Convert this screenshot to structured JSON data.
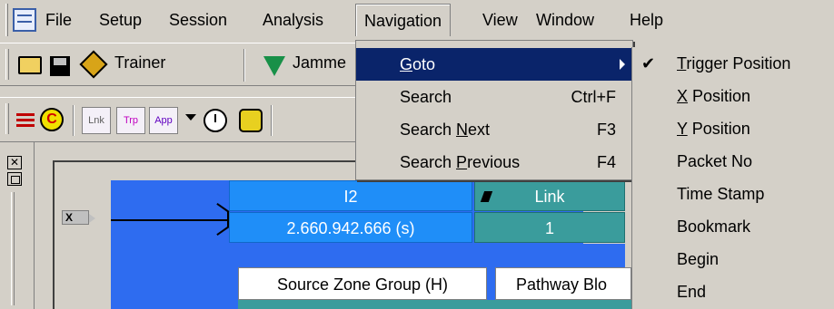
{
  "menubar": {
    "items": [
      "File",
      "Setup",
      "Session",
      "Analysis",
      "Navigation",
      "View",
      "Window",
      "Help"
    ]
  },
  "toolbar1": {
    "trainer_label": "Trainer",
    "jammer_label": "Jamme"
  },
  "toolbar2": {
    "lnk": "Lnk",
    "trp": "Trp",
    "app": "App",
    "c_label": "C"
  },
  "trace": {
    "x_badge": "X",
    "cells": {
      "i2": "I2",
      "time": "2.660.942.666 (s)",
      "link": "Link",
      "one": "1",
      "source_zone": "Source Zone Group (H)",
      "pathway": "Pathway Blo"
    }
  },
  "dropdown": {
    "items": [
      {
        "prefix": "",
        "u": "G",
        "rest": "oto",
        "shortcut": ""
      },
      {
        "prefix": "Search",
        "u": "",
        "rest": "",
        "shortcut": "Ctrl+F"
      },
      {
        "prefix": "Search ",
        "u": "N",
        "rest": "ext",
        "shortcut": "F3"
      },
      {
        "prefix": "Search ",
        "u": "P",
        "rest": "revious",
        "shortcut": "F4"
      }
    ]
  },
  "submenu": {
    "items": [
      {
        "u": "T",
        "rest": "rigger Position"
      },
      {
        "u": "X",
        "rest": " Position"
      },
      {
        "u": "Y",
        "rest": " Position"
      },
      {
        "u": "",
        "rest": "Packet No"
      },
      {
        "u": "",
        "rest": "Time Stamp"
      },
      {
        "u": "",
        "rest": "Bookmark"
      },
      {
        "u": "",
        "rest": "Begin"
      },
      {
        "u": "",
        "rest": "End"
      }
    ],
    "check": "✔"
  }
}
